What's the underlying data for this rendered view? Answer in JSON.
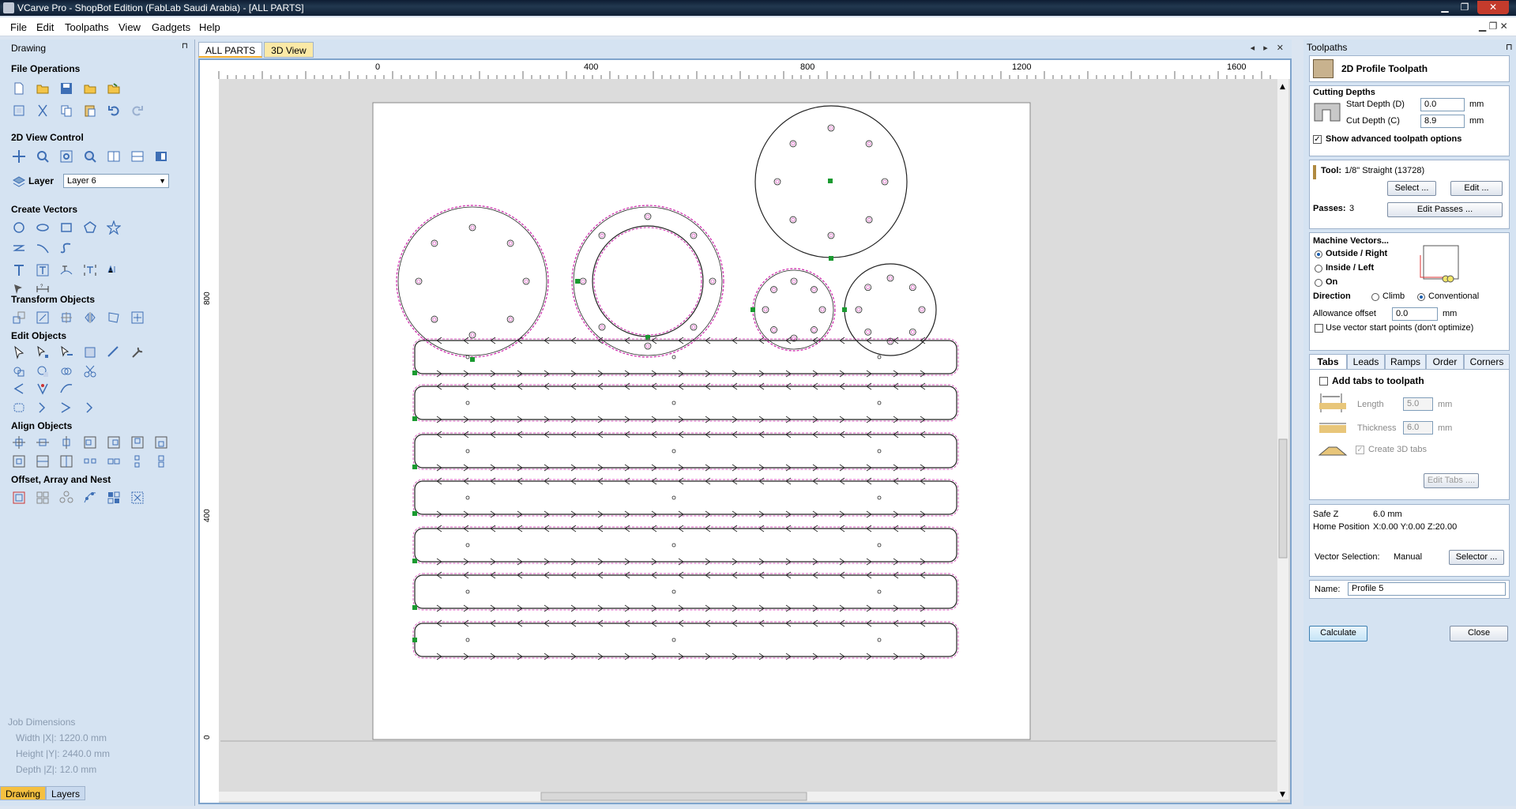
{
  "window": {
    "title": "VCarve Pro - ShopBot Edition (FabLab Saudi Arabia) - [ALL PARTS]",
    "minimize": "▁",
    "maximize": "❐",
    "close": "✕"
  },
  "menu": {
    "items": [
      "File",
      "Edit",
      "Toolpaths",
      "View",
      "Gadgets",
      "Help"
    ],
    "mdi_controls": "▁ ❐ ✕"
  },
  "left": {
    "title": "Drawing",
    "pin": "⊓",
    "sections": {
      "file_ops": "File Operations",
      "view_control": "2D View Control",
      "create_vectors": "Create Vectors",
      "transform": "Transform Objects",
      "edit_objects": "Edit Objects",
      "align": "Align Objects",
      "offset": "Offset, Array and Nest"
    },
    "layer_label": "Layer",
    "layer_value": "Layer 6",
    "job": {
      "title": "Job Dimensions",
      "width": "Width  |X|: 1220.0 mm",
      "height": "Height |Y|: 2440.0 mm",
      "depth": "Depth  |Z|: 12.0 mm"
    },
    "bottom_tabs": [
      "Drawing",
      "Layers"
    ]
  },
  "center": {
    "tabs": [
      "ALL PARTS",
      "3D View"
    ],
    "nav": "◂ ▸ ✕",
    "ruler_x": [
      "0",
      "400",
      "800",
      "1200",
      "1600"
    ],
    "ruler_y": [
      "800",
      "400",
      "0"
    ]
  },
  "right": {
    "title": "Toolpaths",
    "pin": "⊓",
    "header": "2D Profile Toolpath",
    "cutting_depths": "Cutting Depths",
    "start_depth_label": "Start Depth (D)",
    "start_depth": "0.0",
    "cut_depth_label": "Cut Depth (C)",
    "cut_depth": "8.9",
    "unit": "mm",
    "show_advanced": "Show advanced toolpath options",
    "tool_label": "Tool:",
    "tool_value": "1/8\" Straight (13728)",
    "select_btn": "Select ...",
    "edit_btn": "Edit ...",
    "passes_label": "Passes:",
    "passes_value": "3",
    "edit_passes_btn": "Edit Passes ...",
    "machine_vectors": "Machine Vectors...",
    "outside": "Outside / Right",
    "inside": "Inside / Left",
    "on": "On",
    "direction": "Direction",
    "climb": "Climb",
    "conventional": "Conventional",
    "allowance_label": "Allowance offset",
    "allowance": "0.0",
    "use_vector_start": "Use vector start points (don't optimize)",
    "tabs": [
      "Tabs",
      "Leads",
      "Ramps",
      "Order",
      "Corners"
    ],
    "add_tabs": "Add tabs to toolpath",
    "length_label": "Length",
    "length": "5.0",
    "thickness_label": "Thickness",
    "thickness": "6.0",
    "create_3d": "Create 3D tabs",
    "edit_tabs_btn": "Edit Tabs ....",
    "safe_z_label": "Safe Z",
    "safe_z": "6.0 mm",
    "home_label": "Home Position",
    "home": "X:0.00 Y:0.00 Z:20.00",
    "vector_sel_label": "Vector Selection:",
    "vector_sel": "Manual",
    "selector_btn": "Selector ...",
    "name_label": "Name:",
    "name": "Profile 5",
    "calculate_btn": "Calculate",
    "close_btn": "Close"
  }
}
